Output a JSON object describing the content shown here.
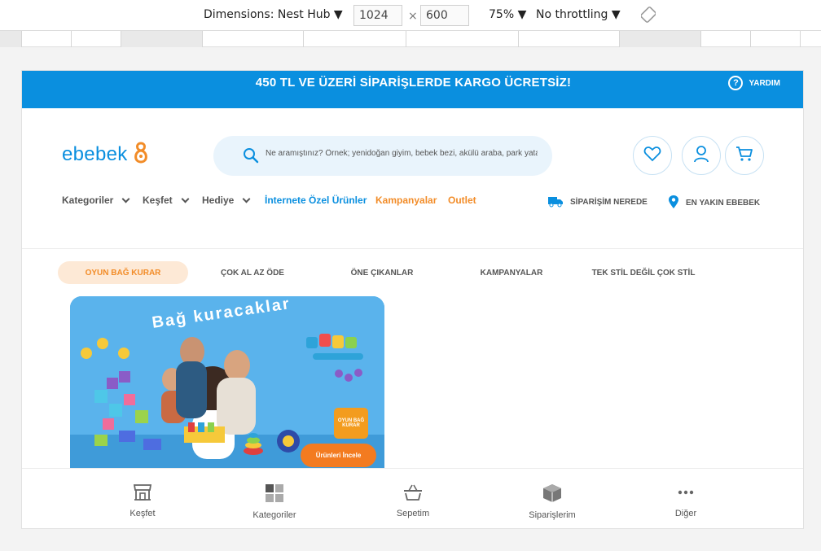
{
  "devtools": {
    "dimensions_label": "Dimensions: Nest Hub",
    "width": "1024",
    "times": "×",
    "height": "600",
    "zoom": "75%",
    "throttle": "No throttling"
  },
  "promo": {
    "text": "450 TL VE ÜZERİ SİPARİŞLERDE KARGO ÜCRETSİZ!",
    "help_label": "YARDIM",
    "color": "#0a8fdf"
  },
  "header": {
    "logo_text": "ebebek",
    "search_placeholder": "Ne aramıştınız? Örnek; yenidoğan giyim, bebek bezi, akülü araba, park yatak"
  },
  "nav": {
    "items": [
      {
        "label": "Kategoriler"
      },
      {
        "label": "Keşfet"
      },
      {
        "label": "Hediye"
      },
      {
        "label": "İnternete Özel Ürünler"
      },
      {
        "label": "Kampanyalar"
      },
      {
        "label": "Outlet"
      }
    ],
    "order_tracking": "SİPARİŞİM NEREDE",
    "nearest_store": "EN YAKIN EBEBEK"
  },
  "tabs": [
    {
      "label": "OYUN BAĞ KURAR",
      "active": true
    },
    {
      "label": "ÇOK AL AZ ÖDE"
    },
    {
      "label": "ÖNE ÇIKANLAR"
    },
    {
      "label": "KAMPANYALAR"
    },
    {
      "label": "TEK STİL DEĞİL ÇOK STİL"
    }
  ],
  "banner": {
    "headline": "Bağ kuracaklar",
    "badge": "OYUN BAĞ KURAR",
    "cta": "Ürünleri İncele"
  },
  "bottom_nav": [
    {
      "label": "Keşfet",
      "icon": "store-icon"
    },
    {
      "label": "Kategoriler",
      "icon": "grid-icon"
    },
    {
      "label": "Sepetim",
      "icon": "basket-icon"
    },
    {
      "label": "Siparişlerim",
      "icon": "box-icon"
    },
    {
      "label": "Diğer",
      "icon": "more-icon"
    }
  ],
  "colors": {
    "brand_blue": "#0a8fdf",
    "brand_orange": "#f28c28"
  }
}
